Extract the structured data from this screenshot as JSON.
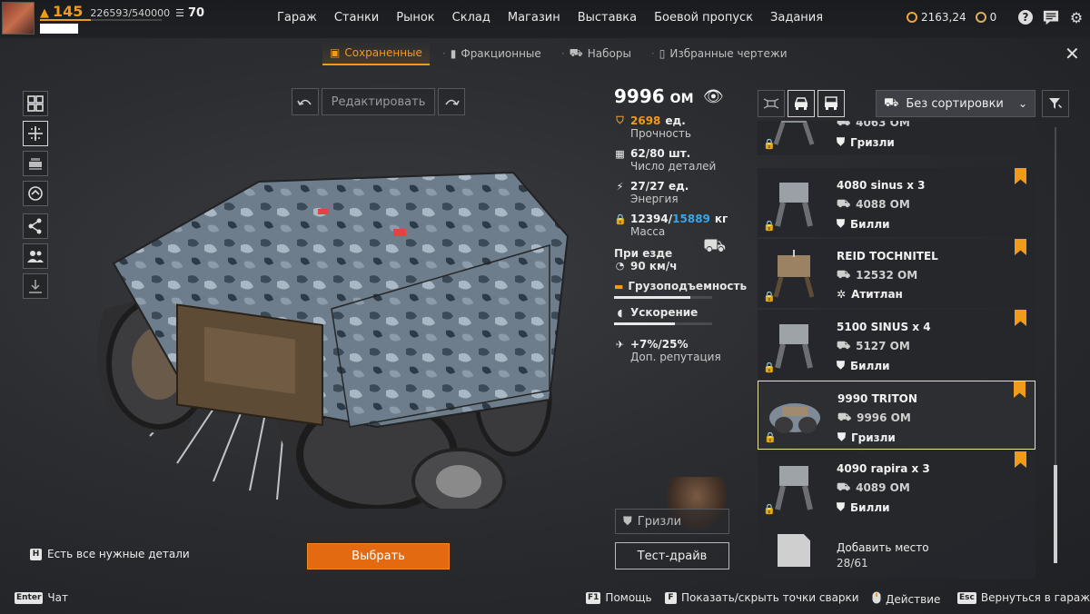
{
  "player": {
    "level": "145",
    "xp": "226593/540000",
    "badge_count": "70",
    "xp_fraction": 0.42
  },
  "nav": [
    "Гараж",
    "Станки",
    "Рынок",
    "Склад",
    "Магазин",
    "Выставка",
    "Боевой пропуск",
    "Задания"
  ],
  "currency": {
    "coins": "2163,24",
    "tokens": "0"
  },
  "subtabs": [
    {
      "label": "Сохраненные",
      "icon": "save-icon"
    },
    {
      "label": "Фракционные",
      "icon": "faction-icon"
    },
    {
      "label": "Наборы",
      "icon": "kit-icon"
    },
    {
      "label": "Избранные чертежи",
      "icon": "bookmark-icon"
    }
  ],
  "edit": {
    "label": "Редактировать"
  },
  "build": {
    "power": "9996",
    "power_unit": "ОМ",
    "durability_value": "2698",
    "durability_unit": "ед.",
    "durability_label": "Прочность",
    "parts_value": "62/80 шт.",
    "parts_label": "Число деталей",
    "energy_value": "27/27 ед.",
    "energy_label": "Энергия",
    "mass_current": "12394",
    "mass_sep": "/",
    "mass_max": "15889",
    "mass_unit": "кг",
    "mass_label": "Масса",
    "driving_label": "При езде",
    "speed": "90 км/ч",
    "load_label": "Грузоподъемность",
    "load_fraction": 0.78,
    "accel_label": "Ускорение",
    "accel_fraction": 0.62,
    "rep_value": "+7%/25%",
    "rep_label": "Доп. репутация"
  },
  "faction_button": "Гризли",
  "test_drive": "Тест-драйв",
  "select_button": "Выбрать",
  "have_all": {
    "key": "H",
    "label": "Есть все нужные детали"
  },
  "sort": {
    "label": "Без сортировки"
  },
  "builds": [
    {
      "name": "",
      "power": "4063 ОМ",
      "faction": "Гризли",
      "bookmark": false
    },
    {
      "name": "4080  sinus x 3",
      "power": "4088 ОМ",
      "faction": "Билли",
      "bookmark": true
    },
    {
      "name": "REID  TOCHNITEL",
      "power": "12532 ОМ",
      "faction": "Атитлан",
      "bookmark": true
    },
    {
      "name": "5100  SINUS x 4",
      "power": "5127 ОМ",
      "faction": "Билли",
      "bookmark": true
    },
    {
      "name": "9990  TRITON",
      "power": "9996 ОМ",
      "faction": "Гризли",
      "bookmark": true
    },
    {
      "name": "4090  rapira x 3",
      "power": "4089 ОМ",
      "faction": "Билли",
      "bookmark": true
    }
  ],
  "add_slot": {
    "label": "Добавить место",
    "count": "28/61"
  },
  "hints": {
    "chat_key": "Enter",
    "chat": "Чат",
    "help_key": "F1",
    "help": "Помощь",
    "weld_key": "F",
    "weld": "Показать/скрыть точки сварки",
    "action": "Действие",
    "back_key": "Esc",
    "back": "Вернуться в гараж"
  },
  "colors": {
    "accent": "#f29a1a",
    "select_button": "#e46a12",
    "mass_max": "#39a6e8"
  }
}
